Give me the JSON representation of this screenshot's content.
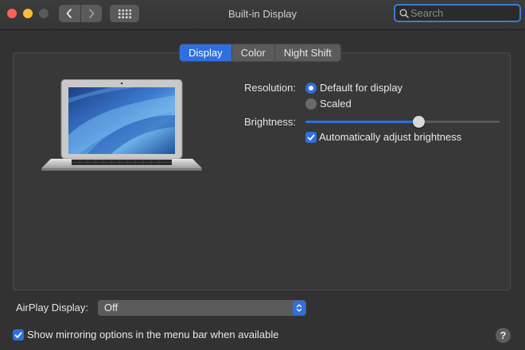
{
  "window": {
    "title": "Built-in Display",
    "search_placeholder": "Search"
  },
  "tabs": [
    {
      "label": "Display",
      "active": true
    },
    {
      "label": "Color",
      "active": false
    },
    {
      "label": "Night Shift",
      "active": false
    }
  ],
  "resolution": {
    "label": "Resolution:",
    "options": [
      {
        "label": "Default for display",
        "selected": true
      },
      {
        "label": "Scaled",
        "selected": false
      }
    ]
  },
  "brightness": {
    "label": "Brightness:",
    "level": 0.58,
    "auto_adjust_label": "Automatically adjust brightness",
    "auto_adjust_checked": true
  },
  "airplay": {
    "label": "AirPlay Display:",
    "value": "Off"
  },
  "mirroring": {
    "label": "Show mirroring options in the menu bar when available",
    "checked": true
  },
  "help": {
    "label": "?"
  },
  "colors": {
    "accent": "#2f6fdf",
    "close": "#ff5f57",
    "minimize": "#febc2e",
    "zoom_inactive": "#5a5a5a"
  },
  "icons": [
    "chevron-left-icon",
    "chevron-right-icon",
    "grid-icon",
    "search-icon",
    "laptop-image",
    "checkmark-icon",
    "up-down-arrows-icon"
  ]
}
